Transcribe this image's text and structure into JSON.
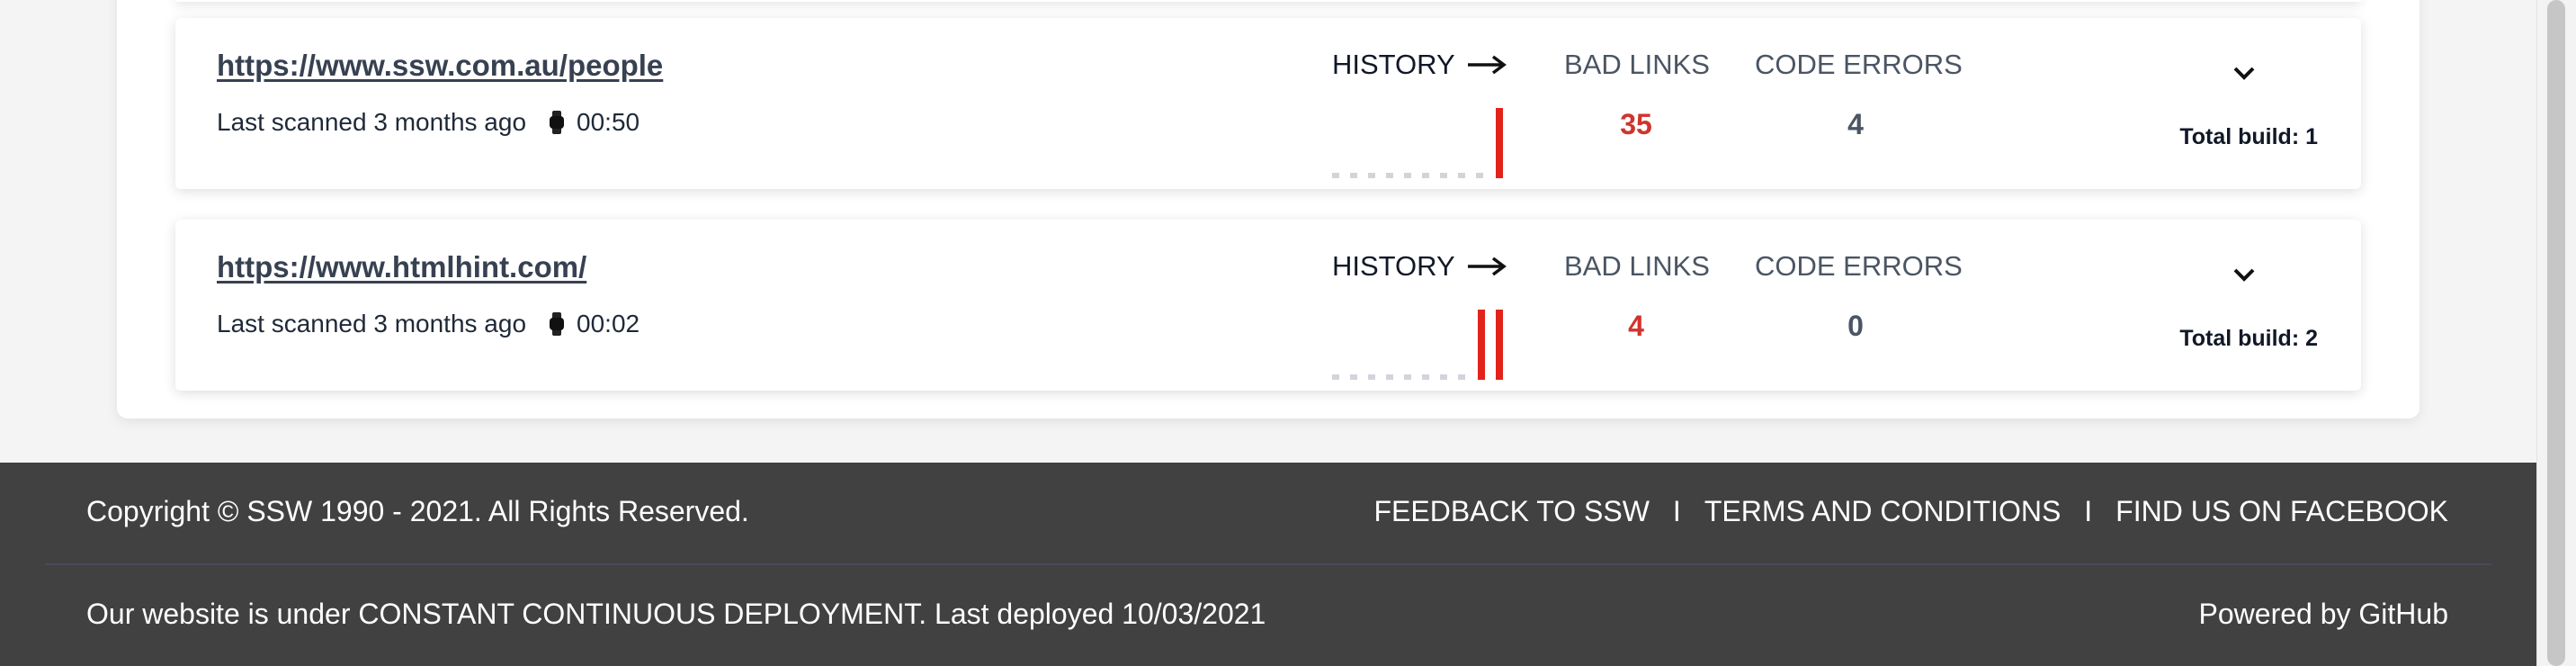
{
  "sites": [
    {
      "url": "https://www.ssw.com.au/people",
      "last_scanned": "Last scanned 3 months ago",
      "duration": "00:50",
      "history_label": "HISTORY",
      "bad_links_label": "BAD LINKS",
      "bad_links": "35",
      "code_errors_label": "CODE ERRORS",
      "code_errors": "4",
      "total_build": "Total build: 1",
      "history_builds": 1
    },
    {
      "url": "https://www.htmlhint.com/",
      "last_scanned": "Last scanned 3 months ago",
      "duration": "00:02",
      "history_label": "HISTORY",
      "bad_links_label": "BAD LINKS",
      "bad_links": "4",
      "code_errors_label": "CODE ERRORS",
      "code_errors": "0",
      "total_build": "Total build: 2",
      "history_builds": 2
    }
  ],
  "footer": {
    "copyright": "Copyright © SSW 1990 - 2021. All Rights Reserved.",
    "links": [
      "FEEDBACK TO SSW",
      "TERMS AND CONDITIONS",
      "FIND US ON FACEBOOK"
    ],
    "separator": "I",
    "deploy_text": "Our website is under CONSTANT CONTINUOUS DEPLOYMENT. Last deployed 10/03/2021",
    "powered_by": "Powered by GitHub"
  },
  "colors": {
    "bad_value": "#d0342c",
    "history_bar": "#e2231a",
    "footer_bg": "#414141"
  },
  "icons": {
    "watch": "watch-icon",
    "arrow": "arrow-right-icon",
    "chevron": "chevron-down-icon"
  }
}
